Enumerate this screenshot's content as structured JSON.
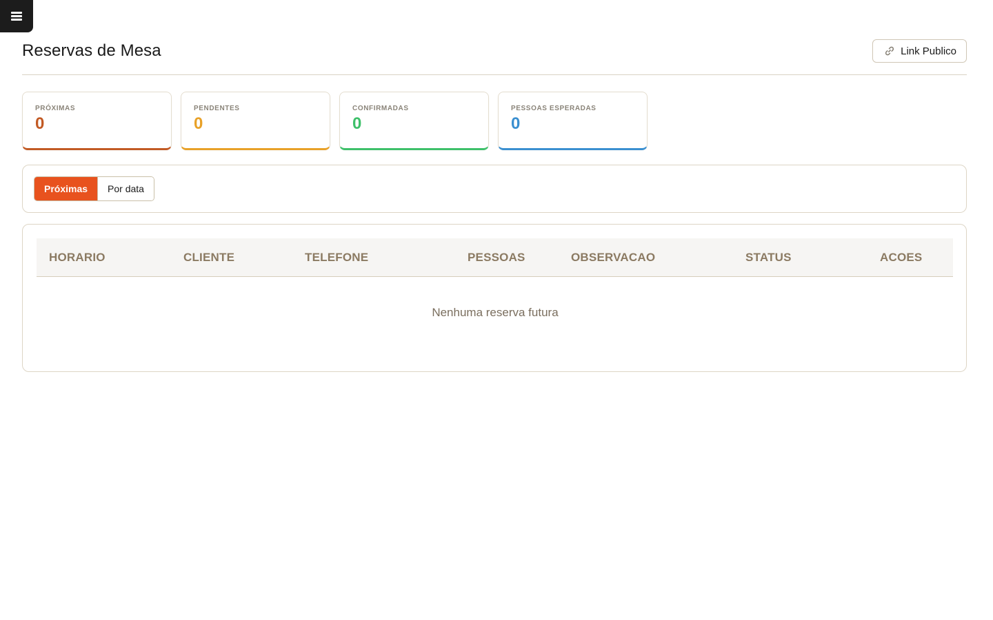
{
  "nav": {
    "menu_icon": "hamburger-menu-icon"
  },
  "header": {
    "title": "Reservas de Mesa",
    "link_button_label": "Link Publico",
    "link_icon": "link-icon"
  },
  "stats": [
    {
      "label": "PRÓXIMAS",
      "value": "0",
      "color": "#c25a24"
    },
    {
      "label": "PENDENTES",
      "value": "0",
      "color": "#e8a128"
    },
    {
      "label": "CONFIRMADAS",
      "value": "0",
      "color": "#3ec06a"
    },
    {
      "label": "PESSOAS ESPERADAS",
      "value": "0",
      "color": "#3a8fd0"
    }
  ],
  "filters": {
    "tabs": [
      {
        "label": "Próximas",
        "active": true
      },
      {
        "label": "Por data",
        "active": false
      }
    ],
    "accent": "#e8521e"
  },
  "table": {
    "columns": [
      "HORARIO",
      "CLIENTE",
      "TELEFONE",
      "PESSOAS",
      "OBSERVACAO",
      "STATUS",
      "ACOES"
    ],
    "empty_message": "Nenhuma reserva futura"
  }
}
